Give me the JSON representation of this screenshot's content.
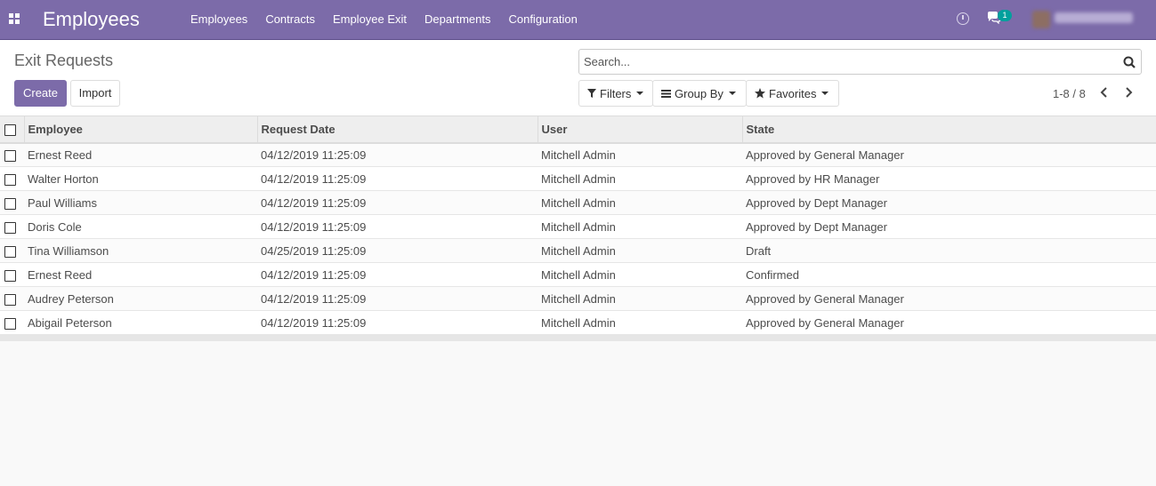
{
  "navbar": {
    "brand": "Employees",
    "menu": [
      "Employees",
      "Contracts",
      "Employee Exit",
      "Departments",
      "Configuration"
    ],
    "chat_badge": "1",
    "user_name": "Mitchell Admin",
    "color": "#7c6ba9"
  },
  "control_panel": {
    "title": "Exit Requests",
    "create_label": "Create",
    "import_label": "Import",
    "search_placeholder": "Search...",
    "filters_label": "Filters",
    "groupby_label": "Group By",
    "favorites_label": "Favorites",
    "pager": "1-8 / 8"
  },
  "table": {
    "columns": [
      "Employee",
      "Request Date",
      "User",
      "State"
    ],
    "rows": [
      {
        "employee": "Ernest Reed",
        "date": "04/12/2019 11:25:09",
        "user": "Mitchell Admin",
        "state": "Approved by General Manager"
      },
      {
        "employee": "Walter Horton",
        "date": "04/12/2019 11:25:09",
        "user": "Mitchell Admin",
        "state": "Approved by HR Manager"
      },
      {
        "employee": "Paul Williams",
        "date": "04/12/2019 11:25:09",
        "user": "Mitchell Admin",
        "state": "Approved by Dept Manager"
      },
      {
        "employee": "Doris Cole",
        "date": "04/12/2019 11:25:09",
        "user": "Mitchell Admin",
        "state": "Approved by Dept Manager"
      },
      {
        "employee": "Tina Williamson",
        "date": "04/25/2019 11:25:09",
        "user": "Mitchell Admin",
        "state": "Draft"
      },
      {
        "employee": "Ernest Reed",
        "date": "04/12/2019 11:25:09",
        "user": "Mitchell Admin",
        "state": "Confirmed"
      },
      {
        "employee": "Audrey Peterson",
        "date": "04/12/2019 11:25:09",
        "user": "Mitchell Admin",
        "state": "Approved by General Manager"
      },
      {
        "employee": "Abigail Peterson",
        "date": "04/12/2019 11:25:09",
        "user": "Mitchell Admin",
        "state": "Approved by General Manager"
      }
    ]
  }
}
